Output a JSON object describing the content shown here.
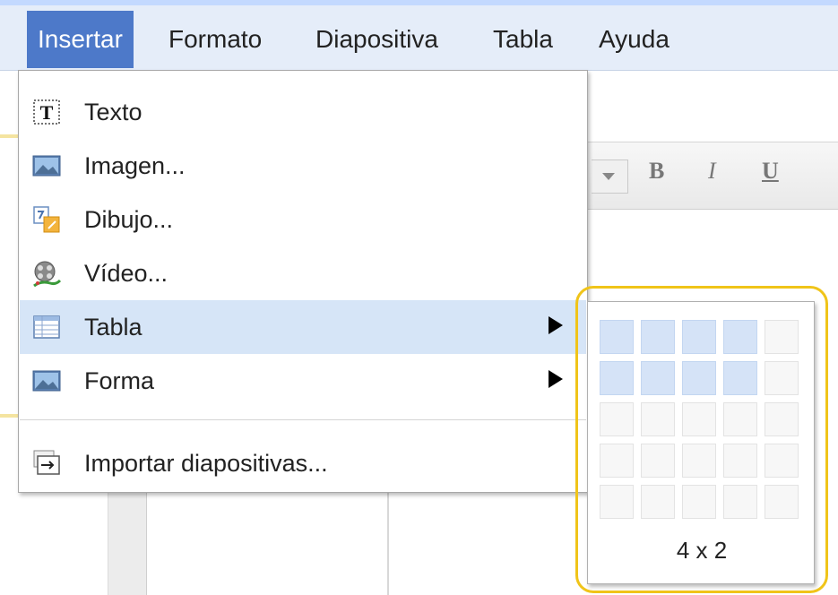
{
  "menubar": {
    "items": [
      "Insertar",
      "Formato",
      "Diapositiva",
      "Tabla",
      "Ayuda"
    ],
    "active_index": 0
  },
  "toolbar": {
    "bold": "B",
    "italic": "I",
    "underline": "U"
  },
  "insert_menu": {
    "items": [
      {
        "label": "Texto",
        "icon": "text-box-icon",
        "has_submenu": false
      },
      {
        "label": "Imagen...",
        "icon": "image-icon",
        "has_submenu": false
      },
      {
        "label": "Dibujo...",
        "icon": "drawing-icon",
        "has_submenu": false
      },
      {
        "label": "Vídeo...",
        "icon": "video-reel-icon",
        "has_submenu": false
      },
      {
        "label": "Tabla",
        "icon": "table-icon",
        "has_submenu": true,
        "highlighted": true
      },
      {
        "label": "Forma",
        "icon": "shape-icon",
        "has_submenu": true
      },
      {
        "label": "Importar diapositivas...",
        "icon": "import-slides-icon",
        "has_submenu": false
      }
    ]
  },
  "table_picker": {
    "columns": 5,
    "rows": 5,
    "selected_columns": 4,
    "selected_rows": 2,
    "label": "4 x 2",
    "highlight_color": "#f0c419",
    "selected_cell_color": "#d5e3f7"
  },
  "colors": {
    "menubar_bg": "#e5edf9",
    "active_menu": "#4d79c9",
    "hover_item": "#d6e5f7"
  }
}
